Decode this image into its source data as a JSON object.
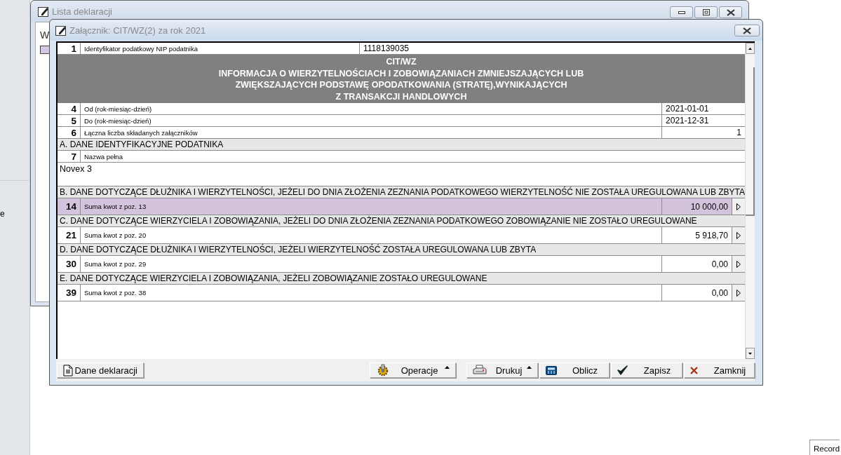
{
  "desktop": {
    "side_text": "e",
    "record_label": "Record"
  },
  "back_window": {
    "title": "Lista deklaracji",
    "cut_label": "W"
  },
  "window": {
    "title": "Załącznik: CIT/WZ(2) za rok 2021"
  },
  "form": {
    "rows": [
      {
        "kind": "wide_field",
        "number": "1",
        "label": "Identyfikator podatkowy NIP podatnika",
        "value": "1118139035"
      },
      {
        "kind": "header",
        "lines": [
          "CIT/WZ",
          "INFORMACJA O WIERZYTELNOŚCIACH I ZOBOWIĄZANIACH ZMNIEJSZAJĄCYCH LUB",
          "ZWIĘKSZAJĄCYCH PODSTAWĘ OPODATKOWANIA (STRATĘ),WYNIKAJĄCYCH",
          "Z TRANSAKCJI HANDLOWYCH"
        ]
      },
      {
        "kind": "field",
        "number": "4",
        "label": "Od (rok-miesiąc-dzień)",
        "value": "2021-01-01"
      },
      {
        "kind": "field",
        "number": "5",
        "label": "Do (rok-miesiąc-dzień)",
        "value": "2021-12-31"
      },
      {
        "kind": "count_field",
        "number": "6",
        "label": "Łączna liczba składanych załączników",
        "value": "1"
      },
      {
        "kind": "section",
        "text": "A. DANE IDENTYFIKACYJNE PODATNIKA"
      },
      {
        "kind": "label_only",
        "number": "7",
        "label": "Nazwa pełna"
      },
      {
        "kind": "text_area",
        "value": "Novex 3"
      },
      {
        "kind": "section",
        "text": "B. DANE DOTYCZĄCE DŁUŻNIKA I WIERZYTELNOŚCI, JEŻELI DO DNIA ZŁOŻENIA ZEZNANIA PODATKOWEGO WIERZYTELNOŚĆ NIE ZOSTAŁA UREGULOWANA LUB ZBYTA"
      },
      {
        "kind": "amount",
        "number": "14",
        "label": "Suma kwot z poz. 13",
        "value": "10 000,00",
        "selected": true
      },
      {
        "kind": "section",
        "text": "C. DANE DOTYCZĄCE WIERZYCIELA I ZOBOWIĄZANIA, JEŻELI DO DNIA ZŁOŻENIA ZEZNANIA PODATKOWEGO ZOBOWIĄZANIE NIE ZOSTAŁO UREGULOWANE"
      },
      {
        "kind": "amount",
        "number": "21",
        "label": "Suma kwot z poz. 20",
        "value": "5 918,70",
        "selected": false
      },
      {
        "kind": "section",
        "text": "D. DANE DOTYCZĄCE DŁUŻNIKA I WIERZYTELNOŚCI, JEŻELI WIERZYTELNOŚĆ ZOSTAŁA UREGULOWANA LUB ZBYTA"
      },
      {
        "kind": "amount",
        "number": "30",
        "label": "Suma kwot z poz. 29",
        "value": "0,00",
        "selected": false
      },
      {
        "kind": "section",
        "text": "E. DANE DOTYCZĄCE WIERZYCIELA I ZOBOWIĄZANIA, JEŻELI ZOBOWIĄZANIE ZOSTAŁO UREGULOWANE"
      },
      {
        "kind": "amount",
        "number": "39",
        "label": "Suma kwot z poz. 38",
        "value": "0,00",
        "selected": false
      }
    ]
  },
  "buttons": [
    {
      "label": "Dane deklaracji",
      "dropdown": false
    },
    {
      "label": "Operacje",
      "dropdown": true
    },
    {
      "label": "Drukuj",
      "dropdown": true
    },
    {
      "label": "Oblicz",
      "dropdown": false
    },
    {
      "label": "Zapisz",
      "dropdown": false
    },
    {
      "label": "Zamknij",
      "dropdown": false
    }
  ]
}
